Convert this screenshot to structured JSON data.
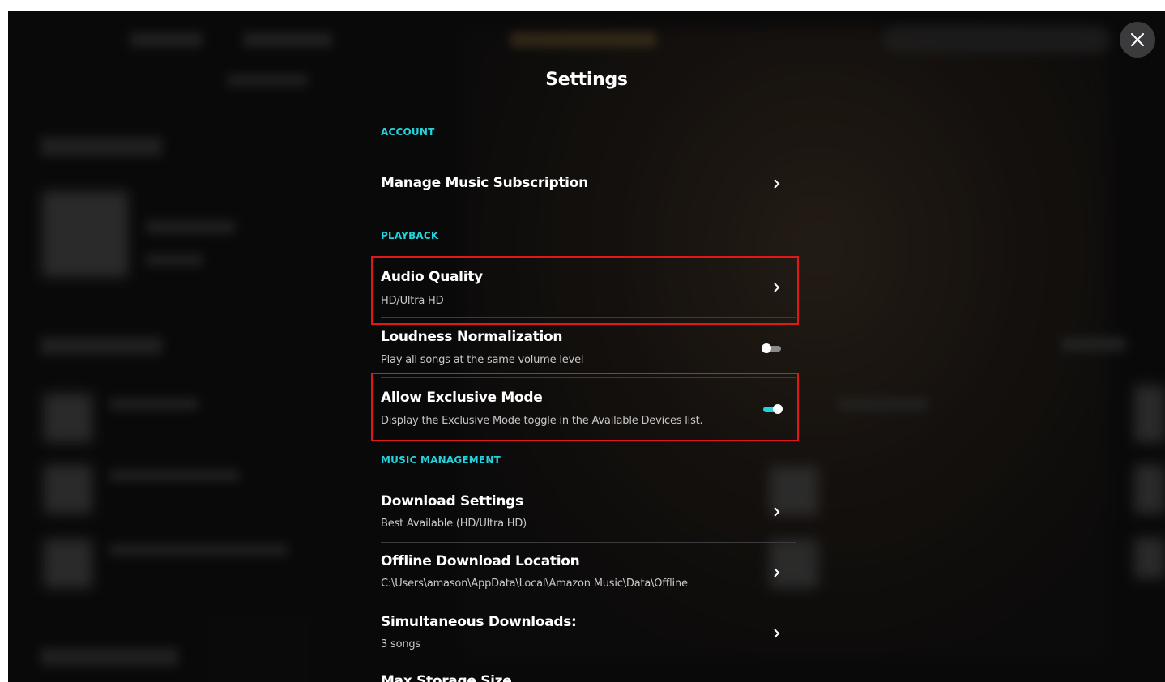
{
  "title": "Settings",
  "close_icon": "close-icon",
  "sections": {
    "account": {
      "label": "ACCOUNT",
      "items": [
        {
          "title": "Manage Music Subscription",
          "icon": "chevron-right-icon"
        }
      ]
    },
    "playback": {
      "label": "PLAYBACK",
      "items": [
        {
          "title": "Audio Quality",
          "subtitle": "HD/Ultra HD",
          "icon": "chevron-right-icon",
          "highlighted": true
        },
        {
          "title": "Loudness Normalization",
          "subtitle": "Play all songs at the same volume level",
          "toggle": false
        },
        {
          "title": "Allow Exclusive Mode",
          "subtitle": "Display the Exclusive Mode toggle in the Available Devices list.",
          "toggle": true,
          "highlighted": true
        }
      ]
    },
    "music_management": {
      "label": "MUSIC MANAGEMENT",
      "items": [
        {
          "title": "Download Settings",
          "subtitle": "Best Available (HD/Ultra HD)",
          "icon": "chevron-right-icon"
        },
        {
          "title": "Offline Download Location",
          "subtitle": "C:\\Users\\amason\\AppData\\Local\\Amazon Music\\Data\\Offline",
          "icon": "chevron-right-icon"
        },
        {
          "title": "Simultaneous Downloads:",
          "subtitle": "3 songs",
          "icon": "chevron-right-icon"
        },
        {
          "title": "Max Storage Size"
        }
      ]
    }
  },
  "colors": {
    "accent": "#25d1da",
    "toggle_on": "#25d1da",
    "toggle_off": "#8a8a8a",
    "highlight": "#e01818",
    "background": "#0f0f10"
  }
}
